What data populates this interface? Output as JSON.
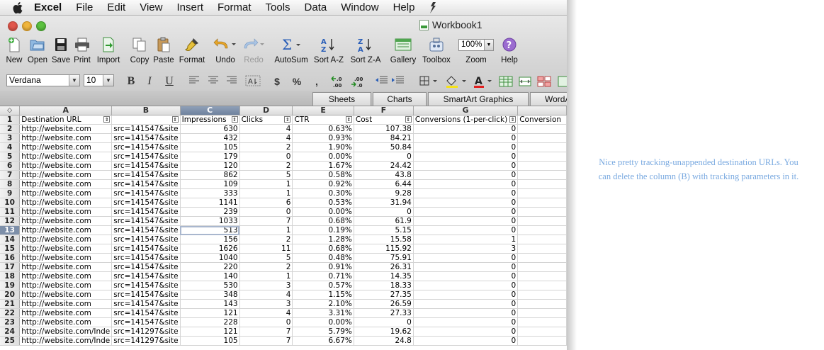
{
  "menubar": {
    "app": "Excel",
    "items": [
      "File",
      "Edit",
      "View",
      "Insert",
      "Format",
      "Tools",
      "Data",
      "Window",
      "Help"
    ]
  },
  "window": {
    "title": "Workbook1"
  },
  "toolbar": {
    "new": "New",
    "open": "Open",
    "save": "Save",
    "print": "Print",
    "import": "Import",
    "copy": "Copy",
    "paste": "Paste",
    "format": "Format",
    "undo": "Undo",
    "redo": "Redo",
    "autosum": "AutoSum",
    "sort_az": "Sort A-Z",
    "sort_za": "Sort Z-A",
    "gallery": "Gallery",
    "toolbox": "Toolbox",
    "zoom": "Zoom",
    "zoom_value": "100%",
    "help": "Help"
  },
  "format_bar": {
    "font": "Verdana",
    "size": "10",
    "bold": "B",
    "italic": "I",
    "underline": "U",
    "currency": "$",
    "percent": "%",
    "comma": ","
  },
  "ribbon": {
    "tabs": [
      "Sheets",
      "Charts",
      "SmartArt Graphics",
      "WordArt"
    ]
  },
  "sheet": {
    "columns": [
      "A",
      "B",
      "C",
      "D",
      "E",
      "F",
      "G",
      ""
    ],
    "selected_cell": "C13",
    "headers": [
      "Destination URL",
      "",
      "Impressions",
      "Clicks",
      "CTR",
      "Cost",
      "Conversions (1-per-click)",
      "Conversion"
    ],
    "rows": [
      [
        "http://website.com",
        "src=141547&site",
        "630",
        "4",
        "0.63%",
        "107.38",
        "0"
      ],
      [
        "http://website.com",
        "src=141547&site",
        "432",
        "4",
        "0.93%",
        "84.21",
        "0"
      ],
      [
        "http://website.com",
        "src=141547&site",
        "105",
        "2",
        "1.90%",
        "50.84",
        "0"
      ],
      [
        "http://website.com",
        "src=141547&site",
        "179",
        "0",
        "0.00%",
        "0",
        "0"
      ],
      [
        "http://website.com",
        "src=141547&site",
        "120",
        "2",
        "1.67%",
        "24.42",
        "0"
      ],
      [
        "http://website.com",
        "src=141547&site",
        "862",
        "5",
        "0.58%",
        "43.8",
        "0"
      ],
      [
        "http://website.com",
        "src=141547&site",
        "109",
        "1",
        "0.92%",
        "6.44",
        "0"
      ],
      [
        "http://website.com",
        "src=141547&site",
        "333",
        "1",
        "0.30%",
        "9.28",
        "0"
      ],
      [
        "http://website.com",
        "src=141547&site",
        "1141",
        "6",
        "0.53%",
        "31.94",
        "0"
      ],
      [
        "http://website.com",
        "src=141547&site",
        "239",
        "0",
        "0.00%",
        "0",
        "0"
      ],
      [
        "http://website.com",
        "src=141547&site",
        "1033",
        "7",
        "0.68%",
        "61.9",
        "0"
      ],
      [
        "http://website.com",
        "src=141547&site",
        "513",
        "1",
        "0.19%",
        "5.15",
        "0"
      ],
      [
        "http://website.com",
        "src=141547&site",
        "156",
        "2",
        "1.28%",
        "15.58",
        "1"
      ],
      [
        "http://website.com",
        "src=141547&site",
        "1626",
        "11",
        "0.68%",
        "115.92",
        "3"
      ],
      [
        "http://website.com",
        "src=141547&site",
        "1040",
        "5",
        "0.48%",
        "75.91",
        "0"
      ],
      [
        "http://website.com",
        "src=141547&site",
        "220",
        "2",
        "0.91%",
        "26.31",
        "0"
      ],
      [
        "http://website.com",
        "src=141547&site",
        "140",
        "1",
        "0.71%",
        "14.35",
        "0"
      ],
      [
        "http://website.com",
        "src=141547&site",
        "530",
        "3",
        "0.57%",
        "18.33",
        "0"
      ],
      [
        "http://website.com",
        "src=141547&site",
        "348",
        "4",
        "1.15%",
        "27.35",
        "0"
      ],
      [
        "http://website.com",
        "src=141547&site",
        "143",
        "3",
        "2.10%",
        "26.59",
        "0"
      ],
      [
        "http://website.com",
        "src=141547&site",
        "121",
        "4",
        "3.31%",
        "27.33",
        "0"
      ],
      [
        "http://website.com",
        "src=141547&site",
        "228",
        "0",
        "0.00%",
        "0",
        "0"
      ],
      [
        "http://website.com/Inde",
        "src=141297&site",
        "121",
        "7",
        "5.79%",
        "19.62",
        "0"
      ],
      [
        "http://website.com/Inde",
        "src=141297&site",
        "105",
        "7",
        "6.67%",
        "24.8",
        "0"
      ]
    ]
  },
  "annotation": "Nice pretty tracking-unappended destination URLs. You can delete the column (B) with tracking parameters in it."
}
